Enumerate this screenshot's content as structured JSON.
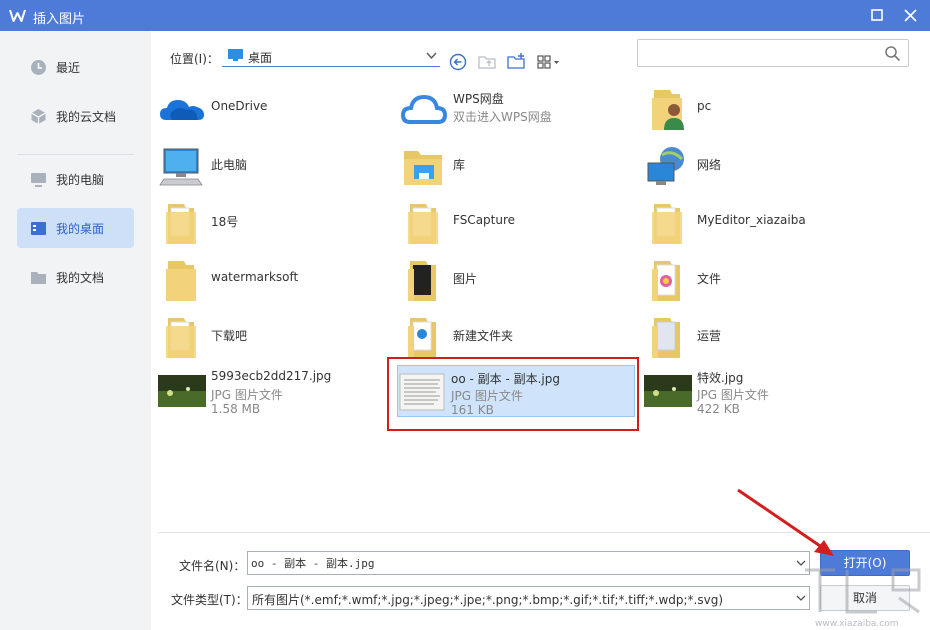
{
  "window": {
    "title": "插入图片"
  },
  "sidebar": {
    "items": [
      {
        "label": "最近"
      },
      {
        "label": "我的云文档"
      },
      {
        "label": "我的电脑"
      },
      {
        "label": "我的桌面"
      },
      {
        "label": "我的文档"
      }
    ],
    "active_index": 3
  },
  "toolbar": {
    "location_label": "位置(I)：",
    "location_value": "桌面",
    "search_placeholder": ""
  },
  "files": [
    {
      "name": "OneDrive",
      "icon": "onedrive-icon"
    },
    {
      "name": "WPS网盘",
      "sub": "双击进入WPS网盘",
      "icon": "wps-cloud-icon"
    },
    {
      "name": "pc",
      "icon": "user-folder-icon"
    },
    {
      "name": "此电脑",
      "icon": "computer-icon"
    },
    {
      "name": "库",
      "icon": "library-icon"
    },
    {
      "name": "网络",
      "icon": "network-icon"
    },
    {
      "name": "18号",
      "icon": "folder-icon"
    },
    {
      "name": "FSCapture",
      "icon": "folder-icon"
    },
    {
      "name": "MyEditor_xiazaiba",
      "icon": "folder-icon"
    },
    {
      "name": "watermarksoft",
      "icon": "folder-icon"
    },
    {
      "name": "图片",
      "icon": "folder-icon"
    },
    {
      "name": "文件",
      "icon": "folder-icon"
    },
    {
      "name": "下载吧",
      "icon": "folder-icon"
    },
    {
      "name": "新建文件夹",
      "icon": "folder-icon"
    },
    {
      "name": "运营",
      "icon": "folder-icon"
    },
    {
      "name": "5993ecb2dd217.jpg",
      "type": "JPG 图片文件",
      "size": "1.58 MB",
      "icon": "image-thumbnail-icon"
    },
    {
      "name": "oo - 副本 - 副本.jpg",
      "type": "JPG 图片文件",
      "size": "161 KB",
      "icon": "document-thumbnail-icon"
    },
    {
      "name": "特效.jpg",
      "type": "JPG 图片文件",
      "size": "422 KB",
      "icon": "image-thumbnail-icon"
    }
  ],
  "selected_index": 16,
  "bottom": {
    "filename_label": "文件名(N)：",
    "filename_value": "oo - 副本 - 副本.jpg",
    "filetype_label": "文件类型(T)：",
    "filetype_value": "所有图片(*.emf;*.wmf;*.jpg;*.jpeg;*.jpe;*.png;*.bmp;*.gif;*.tif;*.tiff;*.wdp;*.svg)",
    "open_label": "打开(O)",
    "cancel_label": "取消"
  },
  "colors": {
    "accent": "#4f7bd8",
    "selected_bg": "#cfe4fb",
    "highlight": "#d21e1e"
  }
}
